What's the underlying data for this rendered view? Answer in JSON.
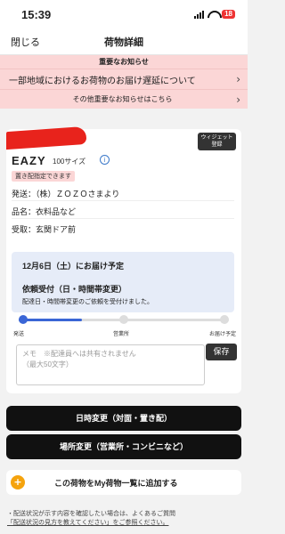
{
  "status": {
    "time": "15:39",
    "battery": "18"
  },
  "nav": {
    "close": "閉じる",
    "title": "荷物詳細"
  },
  "notice": {
    "header": "重要なお知らせ",
    "item1": "一部地域におけるお荷物のお届け遅延について",
    "item2": "その他重要なお知らせはこちら"
  },
  "package": {
    "widget_label": "ウィジェット\n登録",
    "brand": "EAZY",
    "size": "100サイズ",
    "tag": "置き配指定できます",
    "sender": "発送：（株）ＺＯＺＯさまより",
    "item": "品名：衣料品など",
    "receive": "受取：玄関ドア前"
  },
  "delivery": {
    "schedule": "12月6日（土）にお届け予定",
    "request": "依頼受付（日・時間帯変更）",
    "request_note": "配達日・時間帯変更のご依頼を受付けました。"
  },
  "progress": {
    "value": 0.3,
    "steps": [
      "発送",
      "営業所",
      "お届け予定"
    ]
  },
  "memo": {
    "placeholder": "メモ　※配達員へは共有されません\n（最大50文字）",
    "save": "保存"
  },
  "actions": {
    "change_time": "日時変更（対面・置き配）",
    "change_place": "場所変更（営業所・コンビニなど）",
    "add_list": "この荷物をMy荷物一覧に追加する"
  },
  "footnote": {
    "line1": "・配送状況が示す内容を確認したい場合は、よくあるご質問",
    "line2": "「配送状況の見方を教えてください」をご参照ください。"
  }
}
